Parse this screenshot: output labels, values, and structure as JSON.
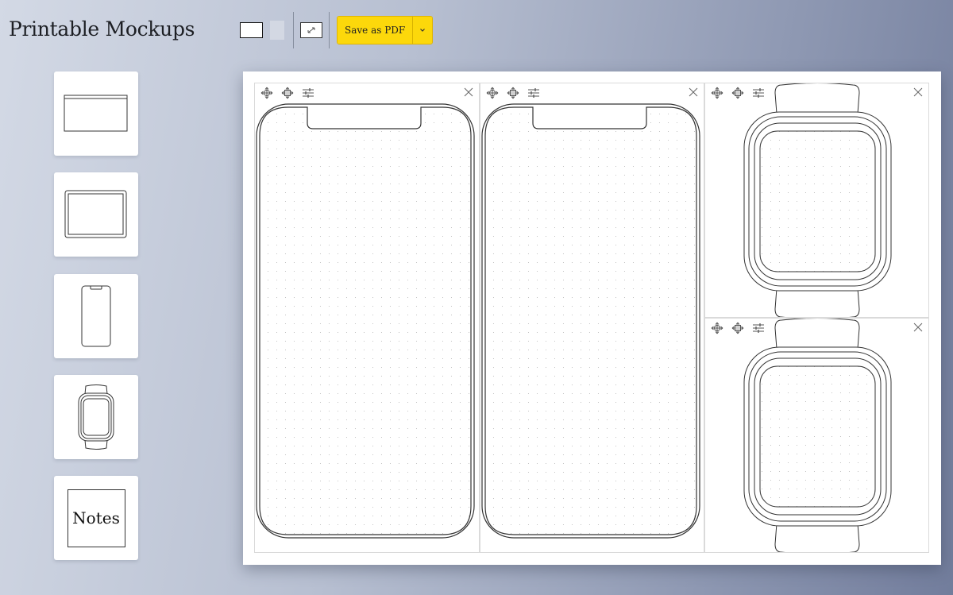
{
  "app": {
    "title": "Printable Mockups"
  },
  "toolbar": {
    "orientation_options": [
      "landscape",
      "portrait"
    ],
    "selected_orientation": "landscape",
    "fit_icon": "fit-screen-icon",
    "save_label": "Save as PDF",
    "save_menu_icon": "chevron-down-icon",
    "accent_color": "#fcd80b"
  },
  "palette": {
    "items": [
      {
        "id": "browser",
        "icon": "browser-window-icon"
      },
      {
        "id": "tablet",
        "icon": "tablet-icon"
      },
      {
        "id": "phone",
        "icon": "phone-icon"
      },
      {
        "id": "watch",
        "icon": "watch-icon"
      },
      {
        "id": "notes",
        "label": "Notes"
      }
    ]
  },
  "canvas": {
    "frames": [
      {
        "device": "phone",
        "tools": [
          "move-icon",
          "move-content-icon",
          "settings-sliders-icon"
        ],
        "close_icon": "close-icon"
      },
      {
        "device": "phone",
        "tools": [
          "move-icon",
          "move-content-icon",
          "settings-sliders-icon"
        ],
        "close_icon": "close-icon"
      },
      {
        "device": "watch",
        "tools": [
          "move-icon",
          "move-content-icon",
          "settings-sliders-icon"
        ],
        "close_icon": "close-icon"
      },
      {
        "device": "watch",
        "tools": [
          "move-icon",
          "move-content-icon",
          "settings-sliders-icon"
        ],
        "close_icon": "close-icon"
      }
    ]
  }
}
